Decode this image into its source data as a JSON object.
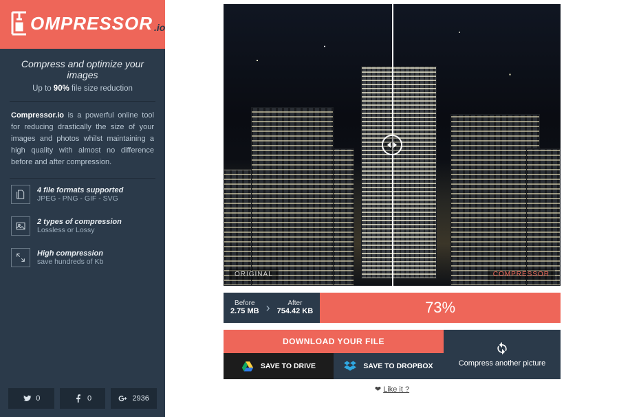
{
  "brand": {
    "name": "OMPRESSOR",
    "suffix": ".io"
  },
  "tagline": "Compress and optimize your images",
  "subline_prefix": "Up to ",
  "subline_pct": "90%",
  "subline_suffix": " file size reduction",
  "description_bold": "Compressor.io",
  "description_rest": " is a powerful online tool for reducing drastically the size of your images and photos whilst maintaining a high quality with almost no difference before and after compression.",
  "features": [
    {
      "title": "4 file formats supported",
      "sub": "JPEG - PNG - GIF - SVG"
    },
    {
      "title": "2 types of compression",
      "sub": "Lossless or Lossy"
    },
    {
      "title": "High compression",
      "sub": "save hundreds of Kb"
    }
  ],
  "social": {
    "twitter": "0",
    "facebook": "0",
    "gplus": "2936"
  },
  "compare": {
    "left_label": "ORIGINAL",
    "right_label": "COMPRESSOR"
  },
  "stats": {
    "before_label": "Before",
    "before_value": "2.75 MB",
    "after_label": "After",
    "after_value": "754.42 KB",
    "percent": "73%"
  },
  "actions": {
    "download": "DOWNLOAD YOUR FILE",
    "drive": "SAVE TO DRIVE",
    "dropbox": "SAVE TO DROPBOX",
    "again": "Compress another picture"
  },
  "likeit_prefix": "❤ ",
  "likeit_link": "Like it ?"
}
